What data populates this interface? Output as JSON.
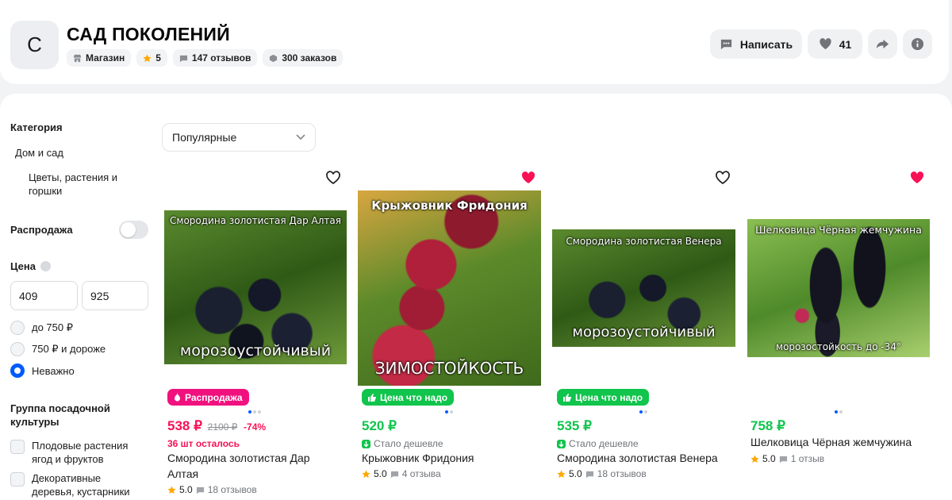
{
  "shop": {
    "avatar_letter": "С",
    "name": "САД ПОКОЛЕНИЙ",
    "chips": [
      {
        "icon": "store-icon",
        "label": "Магазин"
      },
      {
        "icon": "star-icon",
        "label": "5"
      },
      {
        "icon": "chat-icon",
        "label": "147 отзывов"
      },
      {
        "icon": "box-icon",
        "label": "300 заказов"
      }
    ],
    "write_label": "Написать",
    "likes_count": "41"
  },
  "filters": {
    "category_title": "Категория",
    "category_parent": "Дом и сад",
    "category_child_line1": "Цветы, растения и",
    "category_child_line2": "горшки",
    "sale_title": "Распродажа",
    "sale_enabled": false,
    "price_title": "Цена",
    "price_min": "409",
    "price_max": "925",
    "price_options": [
      "до 750 ₽",
      "750 ₽ и дороже",
      "Неважно"
    ],
    "price_selected": "Неважно",
    "group_title_line1": "Группа посадочной",
    "group_title_line2": "культуры",
    "groups": [
      {
        "line1": "Плодовые растения",
        "line2": "ягод и фруктов"
      },
      {
        "line1": "Декоративные",
        "line2": "деревья, кустарники"
      }
    ]
  },
  "sort": {
    "selected": "Популярные"
  },
  "products": [
    {
      "favorited": false,
      "image_caption_top": "Смородина золотистая Дар Алтая",
      "image_caption_bottom": "морозоустойчивый",
      "badge": "Распродажа",
      "badge_color": "#f1117e",
      "price": "538 ₽",
      "old_price": "2100 ₽",
      "discount": "-74%",
      "subtext": "36 шт осталось",
      "name_line1": "Смородина золотистая Дар",
      "name_line2": "Алтая",
      "rating": "5.0",
      "reviews": "18 отзывов"
    },
    {
      "favorited": true,
      "image_caption_top": "Крыжовник Фридония",
      "image_caption_bottom": "ЗИМОСТОЙКОСТЬ",
      "badge": "Цена что надо",
      "badge_color": "#10c44c",
      "price": "520 ₽",
      "subtext": "Стало дешевле",
      "name_line1": "Крыжовник Фридония",
      "rating": "5.0",
      "reviews": "4 отзыва"
    },
    {
      "favorited": false,
      "image_caption_top": "Смородина золотистая Венера",
      "image_caption_bottom": "морозоустойчивый",
      "badge": "Цена что надо",
      "badge_color": "#10c44c",
      "price": "535 ₽",
      "subtext": "Стало дешевле",
      "name_line1": "Смородина золотистая Венера",
      "rating": "5.0",
      "reviews": "18 отзывов"
    },
    {
      "favorited": true,
      "image_caption_top": "Шелковица Чёрная жемчужина",
      "image_caption_bottom": "морозостойкость до -34°",
      "price": "758 ₽",
      "name_line1": "Шелковица Чёрная жемчужина",
      "rating": "5.0",
      "reviews": "1 отзыв"
    }
  ],
  "colors": {
    "price_green": "#10c44c",
    "price_red": "#f91155",
    "accent_blue": "#005bff"
  }
}
